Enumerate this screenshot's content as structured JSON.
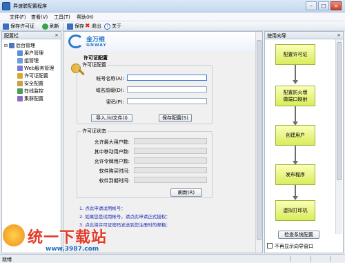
{
  "window": {
    "title": "异速联配置程序"
  },
  "menu": [
    "文件(F)",
    "查看(V)",
    "工具(T)",
    "帮助(H)"
  ],
  "toolbar_left": {
    "save_license": "保存许可证",
    "refresh": "刷新"
  },
  "toolbar_right": {
    "save": "保存",
    "logout": "退出",
    "close": "关于"
  },
  "left_panel": {
    "title": "配置栏",
    "pin": "×",
    "root": "后台管理",
    "items": [
      "用户管理",
      "组管理",
      "Web服务管理",
      "许可证配置",
      "安全配置",
      "在线监控",
      "集群配置"
    ]
  },
  "center": {
    "logo_text": "金万维",
    "logo_sub": "GNWAY",
    "section_title": "许可证配置",
    "license_group": "许可证配置",
    "fields": {
      "account": "帐号名称(A):",
      "domain": "域名前缀(D):",
      "password": "密码(P):"
    },
    "buttons": {
      "import": "导入.lid文件(I)",
      "save_cfg": "保存配置(S)"
    },
    "status_group": "许可证状态",
    "status_fields": [
      "允许最大用户数:",
      "其中移动用户数:",
      "允许令牌用户数:",
      "软件购买时间:",
      "软件到期时间:"
    ],
    "refresh": "刷新(R)",
    "notes": [
      "1. 点此申请试用帐号：",
      "2. 如果您是试用帐号，请点此申请正式授权：",
      "3. 点此将许可证密码发送到您注册时的邮箱："
    ]
  },
  "wizard": {
    "title": "使用向导",
    "pin": "×",
    "steps": [
      "配置许可证",
      "配置防火墙\n做端口映射",
      "创建用户",
      "发布程序",
      "虚拟打印机"
    ],
    "check_button": "检查系统配置",
    "no_show": "不再显示向导窗口"
  },
  "status": {
    "text": "就绪"
  },
  "watermark": {
    "main": "统一下载站",
    "url": "www.3987.com"
  }
}
